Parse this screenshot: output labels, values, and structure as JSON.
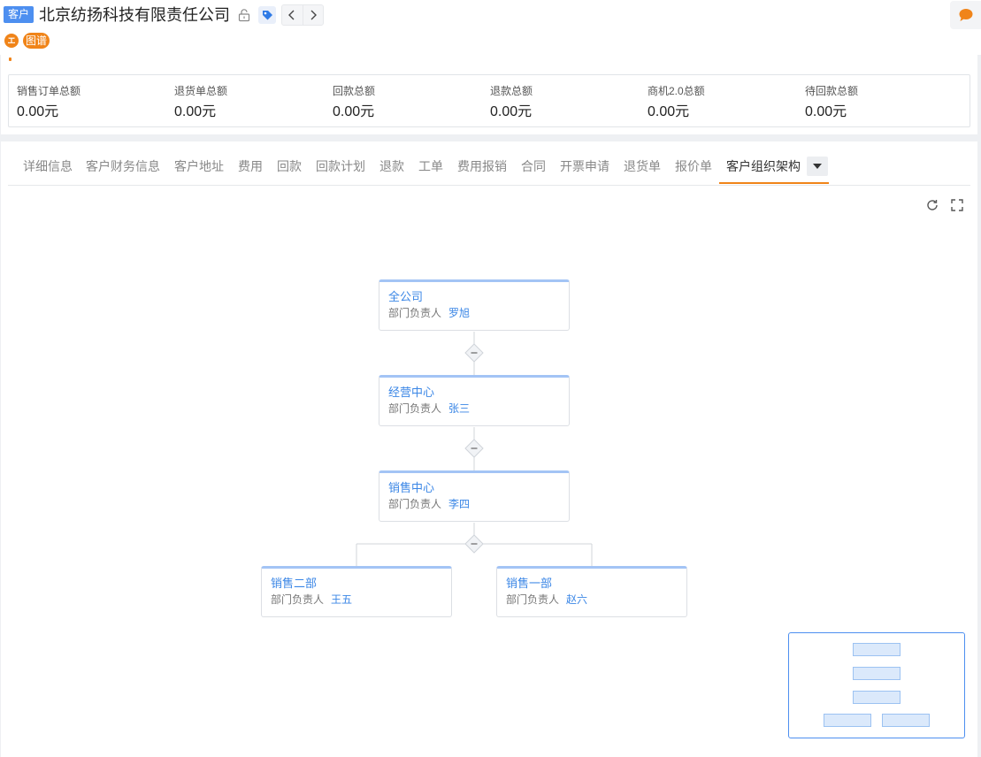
{
  "header": {
    "type_badge": "客户",
    "company_name": "北京纺扬科技有限责任公司",
    "owner_initial": "エ",
    "graph_tag": "图谱"
  },
  "summary": {
    "items": [
      {
        "label": "销售订单总额",
        "value": "0.00元"
      },
      {
        "label": "退货单总额",
        "value": "0.00元"
      },
      {
        "label": "回款总额",
        "value": "0.00元"
      },
      {
        "label": "退款总额",
        "value": "0.00元"
      },
      {
        "label": "商机2.0总额",
        "value": "0.00元"
      },
      {
        "label": "待回款总额",
        "value": "0.00元"
      }
    ]
  },
  "tabs": [
    {
      "label": "详细信息"
    },
    {
      "label": "客户财务信息"
    },
    {
      "label": "客户地址"
    },
    {
      "label": "费用"
    },
    {
      "label": "回款"
    },
    {
      "label": "回款计划"
    },
    {
      "label": "退款"
    },
    {
      "label": "工单"
    },
    {
      "label": "费用报销"
    },
    {
      "label": "合同"
    },
    {
      "label": "开票申请"
    },
    {
      "label": "退货单"
    },
    {
      "label": "报价单"
    },
    {
      "label": "客户组织架构"
    }
  ],
  "active_tab": "客户组织架构",
  "org": {
    "role_label": "部门负责人",
    "nodes": [
      {
        "name": "全公司",
        "head": "罗旭"
      },
      {
        "name": "经营中心",
        "head": "张三"
      },
      {
        "name": "销售中心",
        "head": "李四"
      },
      {
        "name": "销售二部",
        "head": "王五"
      },
      {
        "name": "销售一部",
        "head": "赵六"
      }
    ]
  },
  "colors": {
    "accent": "#f08419",
    "primary": "#3a86e6",
    "node_border_top": "#a3c4f5"
  },
  "icons": [
    "lock-icon",
    "tag-icon",
    "chevron-left-icon",
    "chevron-right-icon",
    "chat-icon",
    "caret-down-icon",
    "refresh-icon",
    "fullscreen-icon",
    "collapse-icon"
  ]
}
